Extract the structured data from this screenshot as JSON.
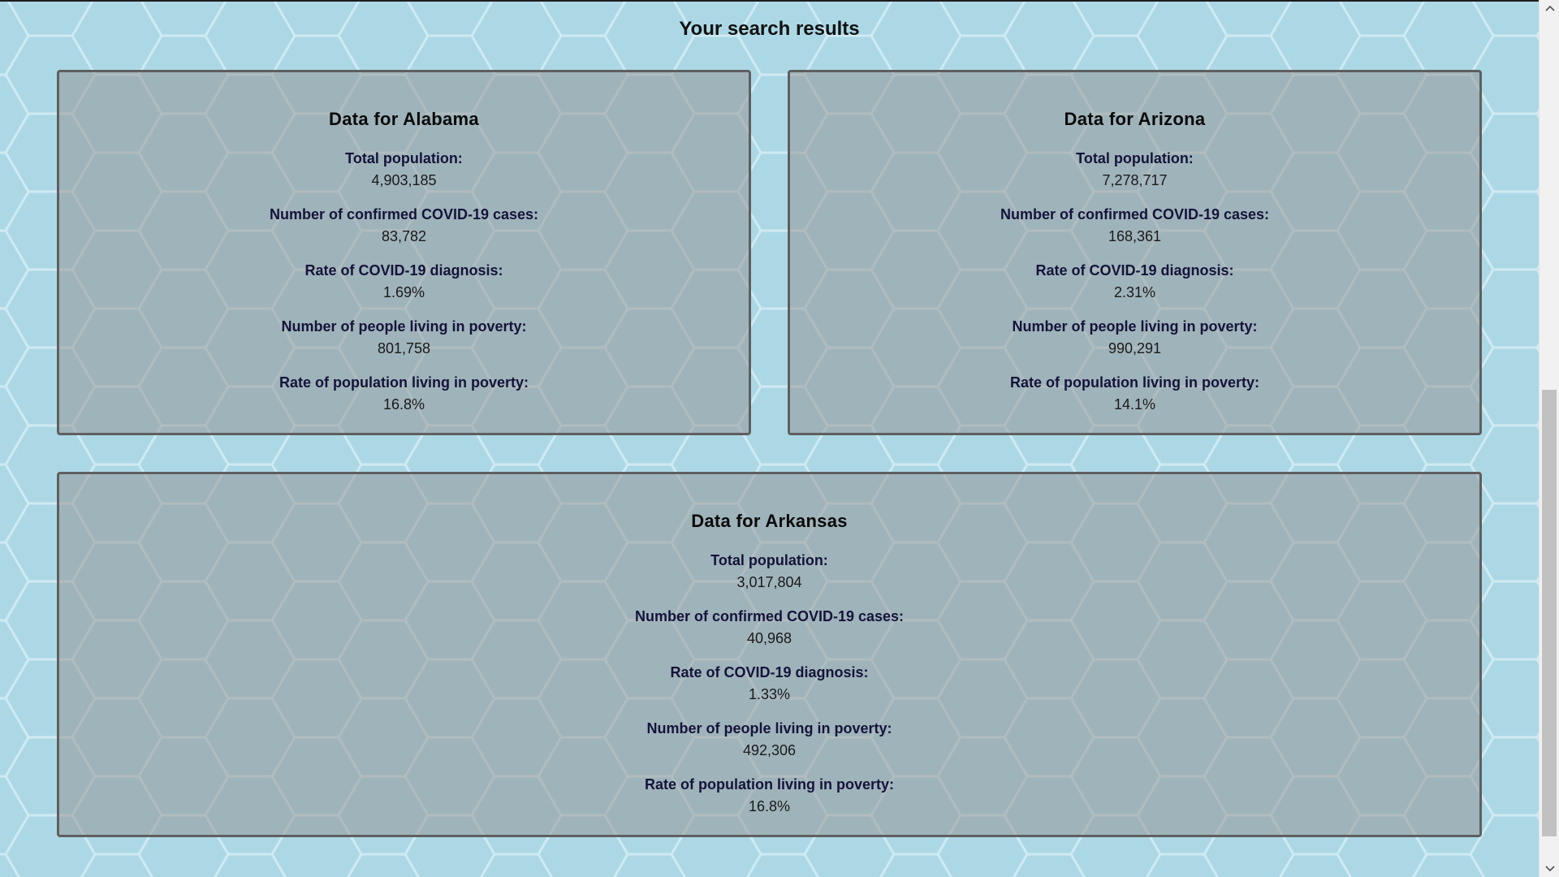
{
  "page": {
    "results_title": "Your search results"
  },
  "states": [
    {
      "title": "Data for Alabama",
      "stats": [
        {
          "label": "Total population:",
          "value": "4,903,185"
        },
        {
          "label": "Number of confirmed COVID-19 cases:",
          "value": "83,782"
        },
        {
          "label": "Rate of COVID-19 diagnosis:",
          "value": "1.69%"
        },
        {
          "label": "Number of people living in poverty:",
          "value": "801,758"
        },
        {
          "label": "Rate of population living in poverty:",
          "value": "16.8%"
        }
      ]
    },
    {
      "title": "Data for Arizona",
      "stats": [
        {
          "label": "Total population:",
          "value": "7,278,717"
        },
        {
          "label": "Number of confirmed COVID-19 cases:",
          "value": "168,361"
        },
        {
          "label": "Rate of COVID-19 diagnosis:",
          "value": "2.31%"
        },
        {
          "label": "Number of people living in poverty:",
          "value": "990,291"
        },
        {
          "label": "Rate of population living in poverty:",
          "value": "14.1%"
        }
      ]
    },
    {
      "title": "Data for Arkansas",
      "stats": [
        {
          "label": "Total population:",
          "value": "3,017,804"
        },
        {
          "label": "Number of confirmed COVID-19 cases:",
          "value": "40,968"
        },
        {
          "label": "Rate of COVID-19 diagnosis:",
          "value": "1.33%"
        },
        {
          "label": "Number of people living in poverty:",
          "value": "492,306"
        },
        {
          "label": "Rate of population living in poverty:",
          "value": "16.8%"
        }
      ]
    }
  ],
  "colors": {
    "background": "#acd8e6",
    "hex_lines": "#d6eef5",
    "card_border": "#5f5f5f",
    "label_text": "#14143a"
  },
  "icons": {
    "scroll_up": "chevron-up-icon",
    "scroll_down": "chevron-down-icon",
    "background_pattern": "hexagon-pattern"
  }
}
